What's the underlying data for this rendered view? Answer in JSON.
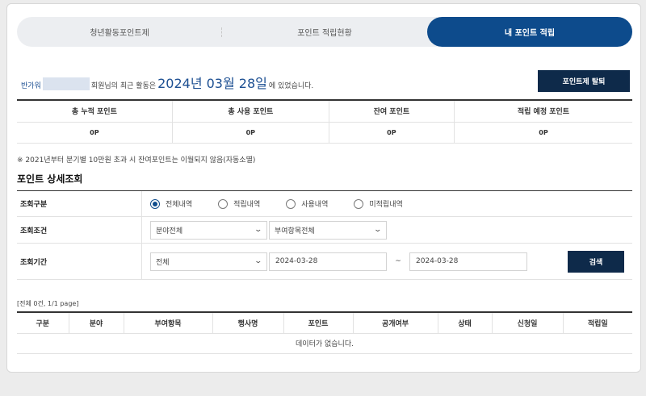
{
  "tabs": [
    {
      "label": "청년활동포인트제",
      "active": false
    },
    {
      "label": "포인트 적립현황",
      "active": false
    },
    {
      "label": "내 포인트 적립",
      "active": true
    }
  ],
  "greeting": {
    "prefix": "반가워",
    "suffix": "회원님의 최근 활동은",
    "date": "2024년 03월 28일",
    "tail": "에 있었습니다."
  },
  "withdraw_button": "포인트제 탈퇴",
  "summary": {
    "headers": [
      "총 누적 포인트",
      "총 사용 포인트",
      "잔여 포인트",
      "적립 예정 포인트"
    ],
    "values": [
      "0P",
      "0P",
      "0P",
      "0P"
    ]
  },
  "notice": "※ 2021년부터 분기별 10만원 초과 시 잔여포인트는 이월되지 않음(자동소멸)",
  "section_title": "포인트 상세조회",
  "filter": {
    "type_label": "조회구분",
    "type_options": [
      "전체내역",
      "적립내역",
      "사용내역",
      "미적립내역"
    ],
    "type_selected": 0,
    "cond_label": "조회조건",
    "cond_field": "분야전체",
    "cond_item": "부여항목전체",
    "period_label": "조회기간",
    "period_select": "전체",
    "date_from": "2024-03-28",
    "date_to": "2024-03-28",
    "tilde": "~",
    "search_button": "검색"
  },
  "result_count": "[전체 0건, 1/1 page]",
  "results": {
    "headers": [
      "구분",
      "분야",
      "부여항목",
      "행사명",
      "포인트",
      "공개여부",
      "상태",
      "신청일",
      "적립일"
    ],
    "empty_message": "데이터가 없습니다."
  },
  "colors": {
    "active_tab": "#0d4b8c",
    "dark_button": "#0e2a4a",
    "date_text": "#1c4f92"
  }
}
